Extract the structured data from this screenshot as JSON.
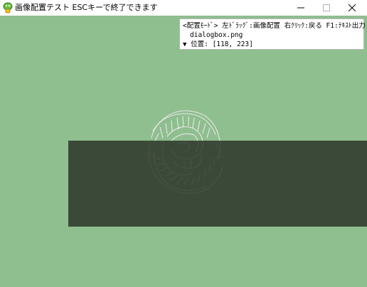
{
  "window": {
    "title": "画像配置テスト ESCキーで終了できます",
    "controls": {
      "minimize_icon": "minimize-icon",
      "maximize_icon": "maximize-icon",
      "close_icon": "close-icon"
    },
    "app_icon": "app-icon"
  },
  "info_panel": {
    "mode_hint": "<配置ﾓｰﾄﾞ> 左ﾄﾞﾗｯｸﾞ:画像配置 右ｸﾘｯｸ:戻る F1:ﾃｷｽﾄ出力",
    "filename": "dialogbox.png",
    "position_arrow": "▼",
    "position_label": "位置:",
    "position_value": "[118, 223]"
  },
  "colors": {
    "canvas_background": "#8fbe8f",
    "dialog_image_fill": "#2d372a",
    "scribble_stroke": "#e8e8e8"
  }
}
